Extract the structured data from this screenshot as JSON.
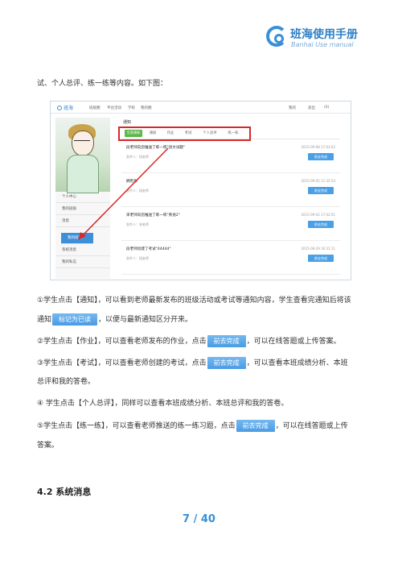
{
  "logo": {
    "cn": "班海使用手册",
    "en": "Banhai Use manual"
  },
  "intro": "试、个人总评、练一练等内容。如下图：",
  "screenshot": {
    "app_name": "班海",
    "nav": [
      "班级圈",
      "平台活动",
      "学校",
      "我的圈"
    ],
    "right": [
      "我的",
      "退出",
      "(0)"
    ],
    "sidebar": [
      "个人中心",
      "我的班级",
      "消息",
      "我的班级",
      "系统消息",
      "我的私信"
    ],
    "main_title": "通知",
    "tabs": [
      "全部通知",
      "通知",
      "作业",
      "考试",
      "个人总评",
      "练一练"
    ],
    "notices": [
      {
        "title": "段老师向您推送了练一练\"语文试题\"",
        "from": "发件人：段老师",
        "time": "2015-09-08 17:03:02",
        "btn": "前去完成"
      },
      {
        "title": "拥有你",
        "from": "发件人：段老师",
        "time": "2015-09-05 11:35:54",
        "btn": "前去完成"
      },
      {
        "title": "宋老师向您推送了练一练\"英语2\"",
        "from": "发件人：宋老师",
        "time": "2015-09-02 17:02:01",
        "btn": "前去完成"
      },
      {
        "title": "段老师创建了考试\"44444\"",
        "from": "发件人：段老师",
        "time": "2015-08-29 16:31:11",
        "btn": "前去完成"
      }
    ]
  },
  "paras": {
    "p1a": "①学生点击【通知】，可以看到老师最新发布的班级活动或考试等通知内容，学生查看完通知后将该",
    "p1b_pre": "通知",
    "p1b_btn": "标记为已读",
    "p1b_post": "，以便与最新通知区分开来。",
    "p2_pre": "②学生点击【作业】，可以查看老师发布的作业，点击",
    "p2_btn": "前去完成",
    "p2_post": "，可以在线答题或上传答案。",
    "p3_pre": "③学生点击【考试】，可以查看老师创建的考试，点击",
    "p3_btn": "前去完成",
    "p3_post": "，可以查看本班成绩分析、本班",
    "p3b": "总评和我的答卷。",
    "p4": "④ 学生点击【个人总评】，同样可以查看本班成绩分析、本班总评和我的答卷。",
    "p5_pre": "⑤学生点击【练一练】，可以查看老师推送的练一练习题，点击",
    "p5_btn": "前去完成",
    "p5_post": "，可以在线答题或上传",
    "p5b": "答案。"
  },
  "section_title": "4.2 系统消息",
  "page": "7 / 40",
  "colors": {
    "accent": "#3a8fd6",
    "button": "#4a9be3",
    "highlight": "#d62a2a",
    "tab_active": "#59b84a"
  }
}
